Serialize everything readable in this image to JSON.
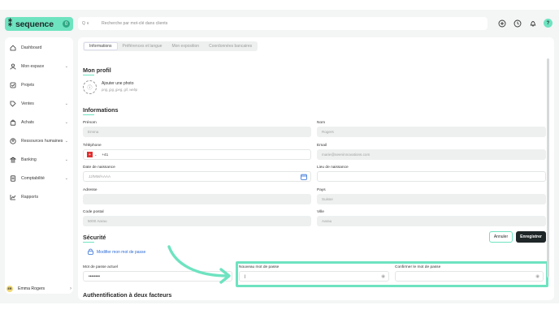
{
  "brand": {
    "name": "sequence",
    "badge": "0"
  },
  "sidebar": {
    "items": [
      {
        "label": "Dashboard",
        "chevron": false
      },
      {
        "label": "Mon espace",
        "chevron": true
      },
      {
        "label": "Projets",
        "chevron": false
      },
      {
        "label": "Ventes",
        "chevron": true
      },
      {
        "label": "Achats",
        "chevron": true
      },
      {
        "label": "Ressources humaines",
        "chevron": true
      },
      {
        "label": "Banking",
        "chevron": true
      },
      {
        "label": "Comptabilité",
        "chevron": true
      },
      {
        "label": "Rapports",
        "chevron": false
      }
    ],
    "user": {
      "initials": "ER",
      "name": "Emma Rogers"
    }
  },
  "search": {
    "prefix": "Q ∨",
    "placeholder": "Recherche par mot-clé dans clients"
  },
  "topbar": {
    "avatar": "?"
  },
  "tabs": [
    "Informations",
    "Préférences et langue",
    "Mon exposition",
    "Coordonnées bancaires"
  ],
  "profile": {
    "title": "Mon profil",
    "photo_title": "Ajouter une photo",
    "photo_sub": "png, jpg, jpeg, gif, webp",
    "photo_icon": "ⓘ"
  },
  "info": {
    "title": "Informations",
    "prenom_label": "Prénom",
    "prenom_value": "Emma",
    "nom_label": "Nom",
    "nom_value": "Rogers",
    "tel_label": "Téléphone",
    "tel_prefix": "+41",
    "email_label": "Email",
    "email_value": "marie@seeninnovations.com",
    "naissance_label": "Date de naissance",
    "naissance_placeholder": "JJ/MM/AAAA",
    "lieu_label": "Lieu de naissance",
    "adresse_label": "Adresse",
    "pays_label": "Pays",
    "pays_value": "Suisse",
    "cp_label": "Code postal",
    "cp_value": "5000 Aarau",
    "ville_label": "Ville",
    "ville_value": "Aarau"
  },
  "security": {
    "title": "Sécurité",
    "cancel": "Annuler",
    "save": "Enregistrer",
    "change_link": "Modifier mon mot de passe",
    "current_label": "Mot de passe actuel",
    "current_value": "••••••••",
    "new_label": "Nouveau mot de passe",
    "new_value": "|",
    "confirm_label": "Confirmer le mot de passe"
  },
  "twofa": {
    "title": "Authentification à deux facteurs"
  },
  "colors": {
    "accent": "#6ee3c0",
    "dark": "#1f2628",
    "link": "#2b6bd6"
  }
}
